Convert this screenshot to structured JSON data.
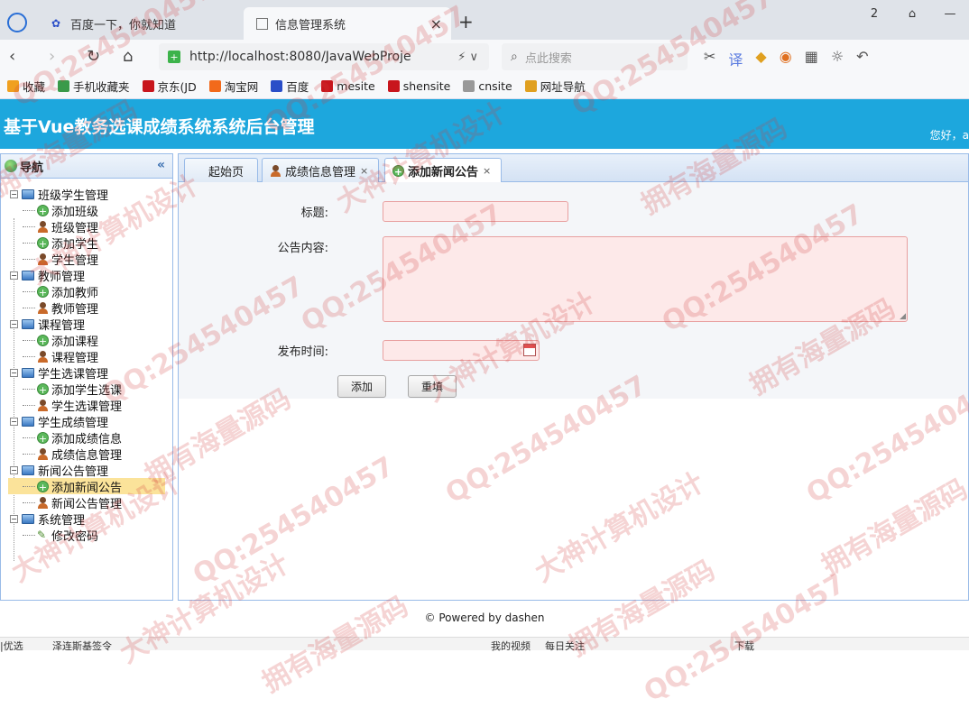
{
  "browser": {
    "tabs": [
      {
        "label": "百度一下，你就知道",
        "icon": "baidu-paw-icon"
      },
      {
        "label": "信息管理系统",
        "icon": "page-icon",
        "close": "×"
      }
    ],
    "new_tab": "+",
    "window_controls": [
      "2",
      "⌂",
      "—"
    ],
    "url": "http://localhost:8080/JavaWebProje",
    "search_placeholder": "点此搜索",
    "bookmarks": [
      {
        "label": "收藏",
        "icon": "star-icon"
      },
      {
        "label": "手机收藏夹",
        "icon": "phone-icon"
      },
      {
        "label": "京东(JD",
        "icon": "jd-icon"
      },
      {
        "label": "淘宝网",
        "icon": "taobao-icon"
      },
      {
        "label": "百度",
        "icon": "baidu-paw-icon"
      },
      {
        "label": "mesite",
        "icon": "mesite-icon"
      },
      {
        "label": "shensite",
        "icon": "shensite-icon"
      },
      {
        "label": "cnsite",
        "icon": "page-icon"
      },
      {
        "label": "网址导航",
        "icon": "nav-icon"
      }
    ]
  },
  "app": {
    "title": "基于Vue教务选课成绩系统系统后台管理",
    "greeting": "您好，a"
  },
  "sidebar": {
    "title": "导航",
    "collapse": "«",
    "groups": [
      {
        "label": "班级学生管理",
        "items": [
          {
            "label": "添加班级",
            "icon": "add-icon"
          },
          {
            "label": "班级管理",
            "icon": "user-icon"
          },
          {
            "label": "添加学生",
            "icon": "add-icon"
          },
          {
            "label": "学生管理",
            "icon": "user-icon"
          }
        ]
      },
      {
        "label": "教师管理",
        "items": [
          {
            "label": "添加教师",
            "icon": "add-icon"
          },
          {
            "label": "教师管理",
            "icon": "user-icon"
          }
        ]
      },
      {
        "label": "课程管理",
        "items": [
          {
            "label": "添加课程",
            "icon": "add-icon"
          },
          {
            "label": "课程管理",
            "icon": "user-icon"
          }
        ]
      },
      {
        "label": "学生选课管理",
        "items": [
          {
            "label": "添加学生选课",
            "icon": "add-icon"
          },
          {
            "label": "学生选课管理",
            "icon": "user-icon"
          }
        ]
      },
      {
        "label": "学生成绩管理",
        "items": [
          {
            "label": "添加成绩信息",
            "icon": "add-icon"
          },
          {
            "label": "成绩信息管理",
            "icon": "user-icon"
          }
        ]
      },
      {
        "label": "新闻公告管理",
        "items": [
          {
            "label": "添加新闻公告",
            "icon": "add-icon",
            "selected": true
          },
          {
            "label": "新闻公告管理",
            "icon": "user-icon"
          }
        ]
      },
      {
        "label": "系统管理",
        "items": [
          {
            "label": "修改密码",
            "icon": "pencil-icon"
          }
        ]
      }
    ]
  },
  "tabs": [
    {
      "label": "起始页"
    },
    {
      "label": "成绩信息管理",
      "close": "×"
    },
    {
      "label": "添加新闻公告",
      "close": "×",
      "active": true
    }
  ],
  "form": {
    "title_label": "标题:",
    "content_label": "公告内容:",
    "date_label": "发布时间:",
    "title_value": "",
    "content_value": "",
    "date_value": "",
    "add_button": "添加",
    "reset_button": "重填"
  },
  "footer": "© Powered by dashen",
  "statusbar": {
    "left": "|优选",
    "left2": "泽连斯基签令",
    "right": [
      "我的视频",
      "每日关注",
      "下载"
    ]
  },
  "watermarks": [
    "QQ:254540457",
    "大神计算机设计",
    "拥有海量源码"
  ],
  "colors": {
    "header": "#1da7dd",
    "input_bg": "#fde9e9",
    "selected": "#fbe39a"
  }
}
